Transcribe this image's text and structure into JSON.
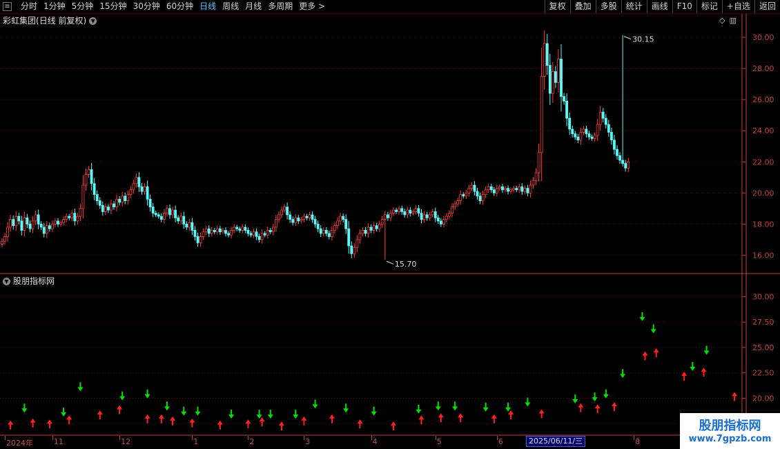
{
  "toolbar": {
    "periods": [
      {
        "label": "分时",
        "active": false
      },
      {
        "label": "1分钟",
        "active": false
      },
      {
        "label": "5分钟",
        "active": false
      },
      {
        "label": "15分钟",
        "active": false
      },
      {
        "label": "30分钟",
        "active": false
      },
      {
        "label": "60分钟",
        "active": false
      },
      {
        "label": "日线",
        "active": true
      },
      {
        "label": "周线",
        "active": false
      },
      {
        "label": "月线",
        "active": false
      },
      {
        "label": "多周期",
        "active": false
      },
      {
        "label": "更多 >",
        "active": false
      }
    ],
    "tools": [
      "复权",
      "叠加",
      "多股",
      "统计",
      "画线",
      "F10",
      "标记",
      "+自选",
      "返回"
    ]
  },
  "stock": {
    "name": "彩虹集团",
    "period_label": "(日线 前复权)"
  },
  "indicator": {
    "name": "股朋指标网"
  },
  "watermark": {
    "line1": "股朋指标网",
    "line2": "www.7gpzb.com"
  },
  "dates": [
    {
      "label": "2024年",
      "i": 1
    },
    {
      "label": "11",
      "i": 18
    },
    {
      "label": "12",
      "i": 42
    },
    {
      "label": "1",
      "i": 68
    },
    {
      "label": "2",
      "i": 88
    },
    {
      "label": "3",
      "i": 108
    },
    {
      "label": "4",
      "i": 132
    },
    {
      "label": "5",
      "i": 155
    },
    {
      "label": "6",
      "i": 177
    },
    {
      "label": "8",
      "i": 226
    }
  ],
  "crosshair_date": "2025/06/11/三",
  "colors": {
    "up": "#ff3c3c",
    "down": "#54fcfc",
    "grid": "#6a0000",
    "axis": "#c04040",
    "arrow_up": "#ff2020",
    "arrow_down": "#00e000"
  },
  "chart_data": [
    {
      "type": "candlestick",
      "title": "彩虹集团(日线 前复权)",
      "ylim": [
        15.0,
        30.8
      ],
      "yticks": [
        16.0,
        18.0,
        20.0,
        22.0,
        24.0,
        26.0,
        28.0,
        30.0
      ],
      "high_label": "30.15",
      "low_label": "15.70",
      "high_index": 222,
      "low_index": 137,
      "closes": [
        16.9,
        17.2,
        17.8,
        18.3,
        17.9,
        18.5,
        18.2,
        17.6,
        18.4,
        18.0,
        17.7,
        18.2,
        18.6,
        18.0,
        17.8,
        17.4,
        17.9,
        17.7,
        18.0,
        18.2,
        18.0,
        18.1,
        18.3,
        18.5,
        18.4,
        18.7,
        18.2,
        18.5,
        19.0,
        20.5,
        21.2,
        21.5,
        20.6,
        19.9,
        19.5,
        19.2,
        18.8,
        19.1,
        18.9,
        19.3,
        19.1,
        19.6,
        19.4,
        19.8,
        19.5,
        19.9,
        20.2,
        20.6,
        21.0,
        20.4,
        20.1,
        20.4,
        19.6,
        19.1,
        18.7,
        18.6,
        18.5,
        18.3,
        18.7,
        19.0,
        18.6,
        18.9,
        18.4,
        18.2,
        18.5,
        18.0,
        17.8,
        18.1,
        17.6,
        17.2,
        16.8,
        17.2,
        17.5,
        17.7,
        17.4,
        17.6,
        17.5,
        17.7,
        17.5,
        17.6,
        17.4,
        17.3,
        17.6,
        17.8,
        17.7,
        17.6,
        17.8,
        17.6,
        17.4,
        17.3,
        17.5,
        17.2,
        17.0,
        17.4,
        17.3,
        17.6,
        17.5,
        17.8,
        18.3,
        18.6,
        18.9,
        19.1,
        18.6,
        18.3,
        18.1,
        18.4,
        18.2,
        18.3,
        18.5,
        18.4,
        18.6,
        18.3,
        18.0,
        17.7,
        17.4,
        17.6,
        17.4,
        17.2,
        17.6,
        17.9,
        18.2,
        18.5,
        18.3,
        17.7,
        16.6,
        16.1,
        16.5,
        17.0,
        17.4,
        17.6,
        17.4,
        17.8,
        17.6,
        17.9,
        17.7,
        18.0,
        18.3,
        18.6,
        18.4,
        18.7,
        18.9,
        18.8,
        19.0,
        18.8,
        18.6,
        18.9,
        18.7,
        18.8,
        19.0,
        18.7,
        18.3,
        18.6,
        18.4,
        18.6,
        18.8,
        18.4,
        18.2,
        18.0,
        18.3,
        18.5,
        18.7,
        19.1,
        19.3,
        19.5,
        19.9,
        19.8,
        20.0,
        20.3,
        20.5,
        20.1,
        19.8,
        19.5,
        19.9,
        20.2,
        20.4,
        20.2,
        20.0,
        20.3,
        20.4,
        20.2,
        20.3,
        20.1,
        20.2,
        20.3,
        20.2,
        20.4,
        20.1,
        20.3,
        20.0,
        20.5,
        20.8,
        21.3,
        22.6,
        27.5,
        29.6,
        28.2,
        26.4,
        27.8,
        27.1,
        28.6,
        26.2,
        25.9,
        24.8,
        24.1,
        23.8,
        23.6,
        23.4,
        23.9,
        24.1,
        23.8,
        23.6,
        23.5,
        23.7,
        24.4,
        25.2,
        24.8,
        24.4,
        23.9,
        23.4,
        22.8,
        22.4,
        22.1,
        21.9,
        21.6,
        22.0
      ]
    },
    {
      "type": "scatter",
      "title": "股朋指标网",
      "ylim": [
        16.5,
        32.0
      ],
      "yticks": [
        17.5,
        20.0,
        22.5,
        25.0,
        27.5,
        30.0
      ],
      "up_arrows": [
        [
          3,
          17.2
        ],
        [
          11,
          17.4
        ],
        [
          17,
          17.3
        ],
        [
          24,
          17.7
        ],
        [
          35,
          18.2
        ],
        [
          42,
          18.7
        ],
        [
          52,
          17.8
        ],
        [
          57,
          17.8
        ],
        [
          61,
          17.6
        ],
        [
          68,
          17.4
        ],
        [
          78,
          17.2
        ],
        [
          88,
          17.3
        ],
        [
          93,
          17.5
        ],
        [
          100,
          17.1
        ],
        [
          108,
          17.6
        ],
        [
          118,
          17.8
        ],
        [
          128,
          17.3
        ],
        [
          140,
          17.1
        ],
        [
          150,
          17.7
        ],
        [
          157,
          17.9
        ],
        [
          164,
          17.9
        ],
        [
          176,
          17.8
        ],
        [
          182,
          18.2
        ],
        [
          193,
          18.3
        ],
        [
          207,
          18.9
        ],
        [
          213,
          18.8
        ],
        [
          219,
          19.0
        ],
        [
          230,
          24.0
        ],
        [
          234,
          24.3
        ],
        [
          244,
          22.0
        ],
        [
          251,
          22.4
        ],
        [
          262,
          20.0
        ]
      ],
      "down_arrows": [
        [
          8,
          19.2
        ],
        [
          22,
          18.8
        ],
        [
          28,
          21.3
        ],
        [
          43,
          20.4
        ],
        [
          52,
          20.6
        ],
        [
          59,
          19.4
        ],
        [
          65,
          18.9
        ],
        [
          70,
          18.9
        ],
        [
          82,
          18.6
        ],
        [
          92,
          18.6
        ],
        [
          96,
          18.6
        ],
        [
          105,
          18.6
        ],
        [
          112,
          19.6
        ],
        [
          123,
          19.2
        ],
        [
          133,
          18.9
        ],
        [
          149,
          19.1
        ],
        [
          156,
          19.4
        ],
        [
          162,
          19.4
        ],
        [
          173,
          19.3
        ],
        [
          181,
          19.3
        ],
        [
          188,
          19.8
        ],
        [
          205,
          20.1
        ],
        [
          212,
          20.3
        ],
        [
          216,
          20.6
        ],
        [
          222,
          22.6
        ],
        [
          229,
          28.2
        ],
        [
          233,
          27.0
        ],
        [
          247,
          23.3
        ],
        [
          252,
          24.9
        ]
      ]
    }
  ]
}
